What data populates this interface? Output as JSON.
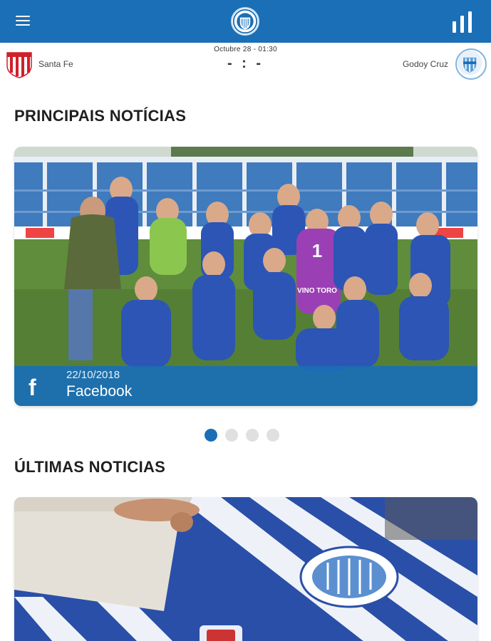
{
  "appbar": {
    "menu_icon": "hamburger-menu-icon",
    "logo_icon": "club-crest-icon",
    "stats_icon": "bar-chart-icon",
    "color": "#1a6fb6"
  },
  "match": {
    "date": "Octubre 28  -  01:30",
    "score": "- : -",
    "home_team": "Santa Fe",
    "away_team": "Godoy Cruz"
  },
  "sections": {
    "principais": "PRINCIPAIS NOTÍCIAS",
    "ultimas": "ÚLTIMAS NOTICIAS"
  },
  "featured": {
    "date": "22/10/2018",
    "source": "Facebook",
    "source_icon": "facebook-icon",
    "photo_number": "1",
    "jersey_text": "VINO TORO"
  },
  "pager": {
    "count": 4,
    "active_index": 0
  }
}
